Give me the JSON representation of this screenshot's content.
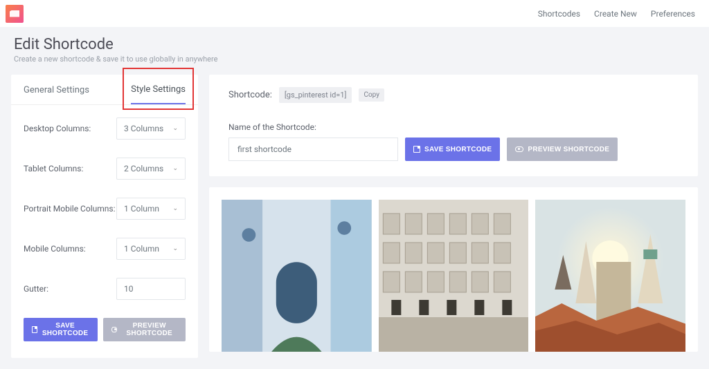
{
  "nav": {
    "items": [
      "Shortcodes",
      "Create New",
      "Preferences"
    ]
  },
  "page": {
    "title": "Edit Shortcode",
    "subtitle": "Create a new shortcode & save it to use globally in anywhere"
  },
  "tabs": {
    "general": "General Settings",
    "style": "Style Settings"
  },
  "fields": {
    "desktop": {
      "label": "Desktop Columns:",
      "value": "3 Columns"
    },
    "tablet": {
      "label": "Tablet Columns:",
      "value": "2 Columns"
    },
    "portrait": {
      "label": "Portrait Mobile Columns:",
      "value": "1 Column"
    },
    "mobile": {
      "label": "Mobile Columns:",
      "value": "1 Column"
    },
    "gutter": {
      "label": "Gutter:",
      "value": "10"
    }
  },
  "buttons": {
    "save": "SAVE SHORTCODE",
    "preview": "PREVIEW SHORTCODE"
  },
  "shortcode": {
    "label": "Shortcode:",
    "code": "[gs_pinterest id=1]",
    "copy": "Copy"
  },
  "nameField": {
    "label": "Name of the Shortcode:",
    "value": "first shortcode"
  }
}
